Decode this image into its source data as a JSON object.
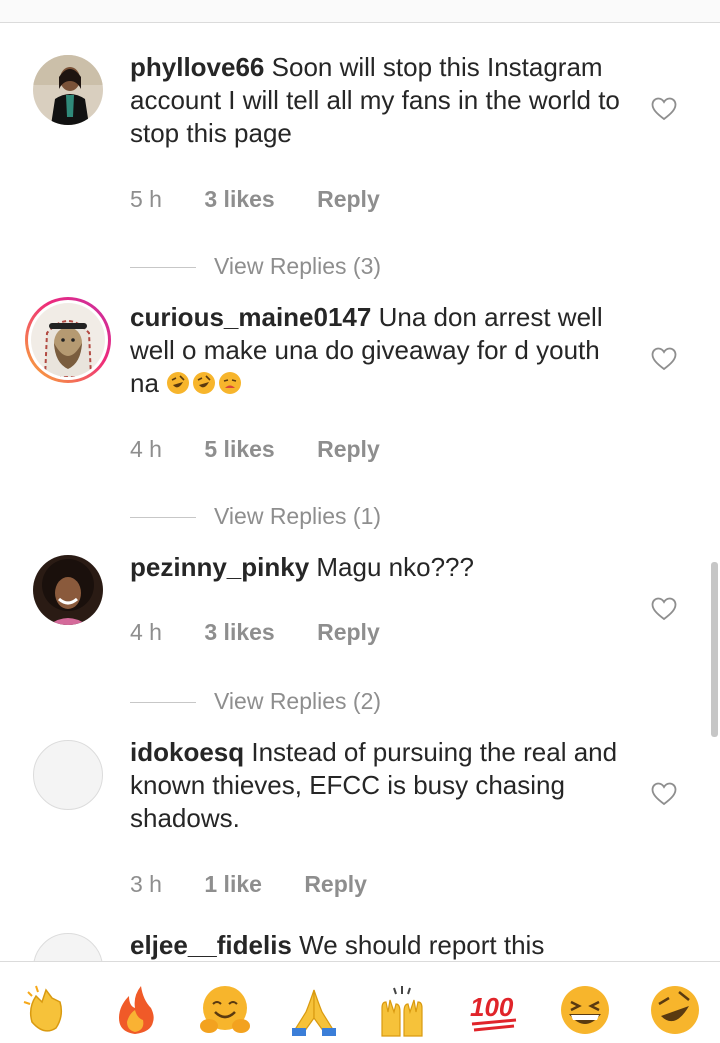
{
  "comments": [
    {
      "username": "phyllove66",
      "text": "Soon will stop this Instagram account  I will tell all my fans in the world to stop this  page",
      "time": "5 h",
      "likes": "3 likes",
      "reply": "Reply",
      "view_replies": "View Replies (3)",
      "avatar": "woman-portrait-photo"
    },
    {
      "username": "curious_maine0147",
      "text": "Una don arrest well well o make una do giveaway for d youth na",
      "time": "4 h",
      "likes": "5 likes",
      "reply": "Reply",
      "view_replies": "View Replies (1)",
      "avatar": "lion-keffiyeh-artwork",
      "text_emojis": [
        "rolling-on-floor-laughing",
        "rolling-on-floor-laughing",
        "tired-face"
      ]
    },
    {
      "username": "pezinny_pinky",
      "text": "Magu nko???",
      "time": "4 h",
      "likes": "3 likes",
      "reply": "Reply",
      "view_replies": "View Replies (2)",
      "avatar": "woman-curly-hair-photo"
    },
    {
      "username": "idokoesq",
      "text": "Instead of pursuing the real and known thieves, EFCC is busy chasing shadows.",
      "time": "3 h",
      "likes": "1 like",
      "reply": "Reply",
      "avatar": "default-avatar"
    },
    {
      "username": "eljee__fidelis",
      "text": "We should report this",
      "avatar": "default-avatar"
    }
  ],
  "reaction_bar": [
    "clapping-hands",
    "fire",
    "hugging-face",
    "folded-hands",
    "raising-hands",
    "hundred-points",
    "grinning-squinting-face",
    "rolling-on-floor-laughing"
  ],
  "colors": {
    "text": "#262626",
    "secondary": "#8e8e8e",
    "story_ring_start": "#f9b234",
    "story_ring_end": "#c22fa6"
  }
}
